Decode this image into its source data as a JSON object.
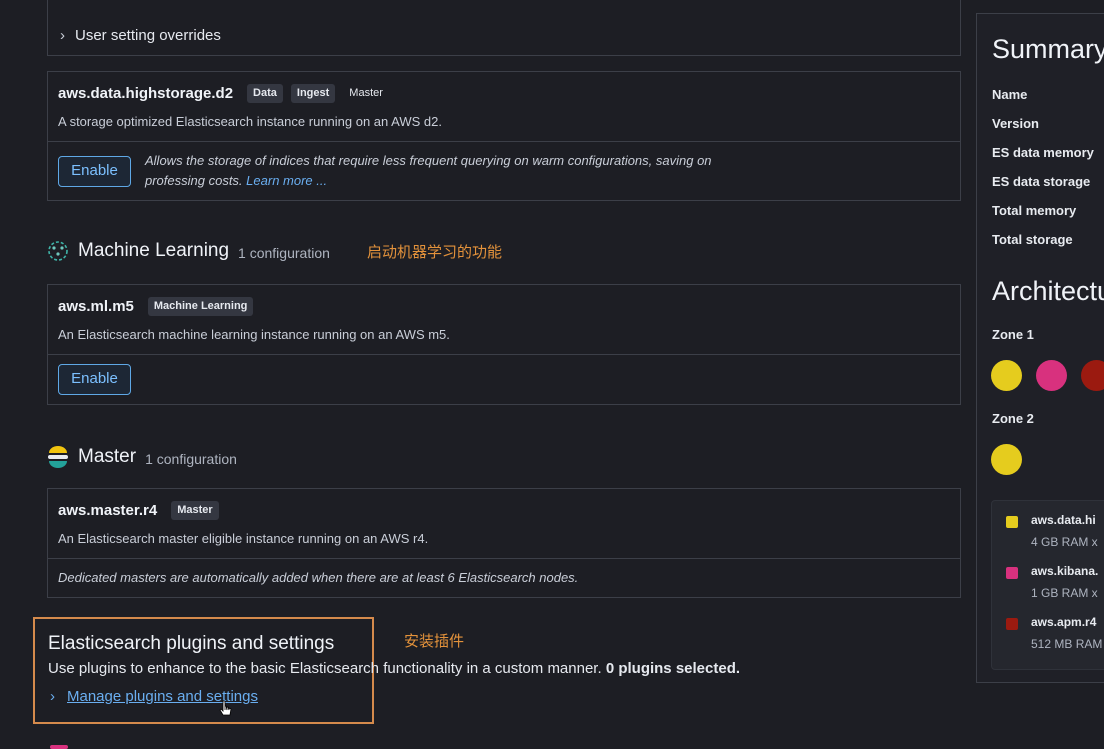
{
  "overrides": {
    "label": "User setting overrides"
  },
  "highstorage": {
    "name": "aws.data.highstorage.d2",
    "badges": [
      "Data",
      "Ingest",
      "Master"
    ],
    "description": "A storage optimized Elasticsearch instance running on an AWS d2.",
    "enable_label": "Enable",
    "note_line1": "Allows the storage of indices that require less frequent querying on warm configurations, saving on",
    "note_line2": "professing costs.",
    "learn_more": "Learn more ..."
  },
  "ml_section": {
    "title": "Machine Learning",
    "count": "1 configuration",
    "annotation": "启动机器学习的功能",
    "name": "aws.ml.m5",
    "badge": "Machine Learning",
    "description": "An Elasticsearch machine learning instance running on an AWS m5.",
    "enable_label": "Enable"
  },
  "master_section": {
    "title": "Master",
    "count": "1 configuration",
    "name": "aws.master.r4",
    "badge": "Master",
    "description": "An Elasticsearch master eligible instance running on an AWS r4.",
    "note": "Dedicated masters are automatically added when there are at least 6 Elasticsearch nodes."
  },
  "plugins": {
    "title": "Elasticsearch plugins and settings",
    "annotation": "安装插件",
    "description": "Use plugins to enhance to the basic Elasticsearch functionality in a custom manner.",
    "selected": "0 plugins selected.",
    "manage_link": "Manage plugins and settings"
  },
  "summary": {
    "title": "Summary",
    "rows": [
      "Name",
      "Version",
      "ES data memory",
      "ES data storage",
      "Total memory",
      "Total storage"
    ]
  },
  "architecture": {
    "title": "Architectu",
    "zone1": "Zone 1",
    "zone2": "Zone 2",
    "legend": [
      {
        "name": "aws.data.hi",
        "sub": "4 GB RAM x",
        "color": "#e5cc1e"
      },
      {
        "name": "aws.kibana.",
        "sub": "1 GB RAM x",
        "color": "#d8317e"
      },
      {
        "name": "aws.apm.r4",
        "sub": "512 MB RAM",
        "color": "#9b1a10"
      }
    ]
  },
  "colors": {
    "data": "#e5cc1e",
    "kibana": "#d8317e",
    "apm": "#9b1a10",
    "accent": "#e3923b"
  }
}
